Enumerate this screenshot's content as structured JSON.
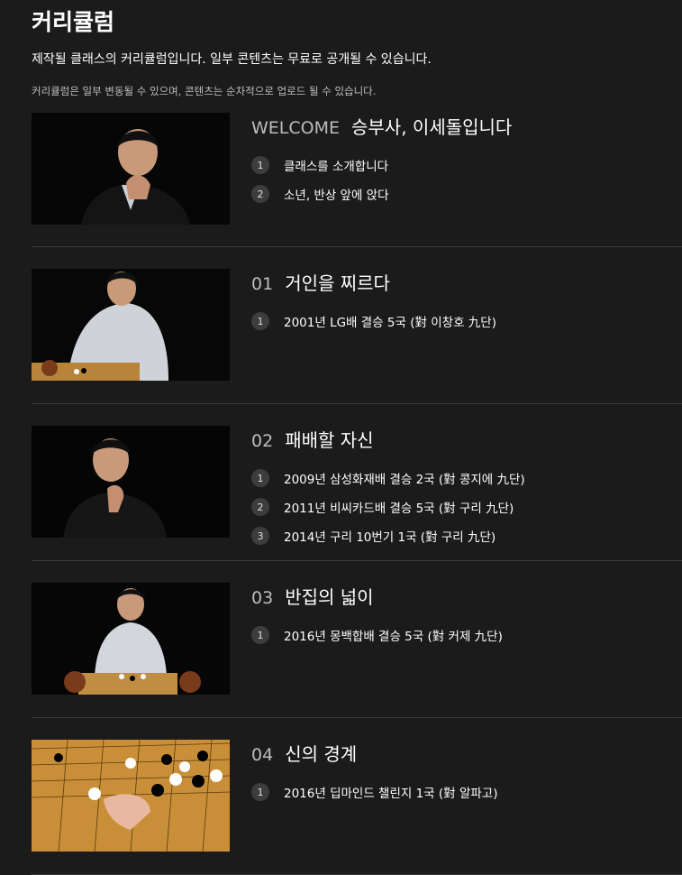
{
  "page": {
    "title": "커리큘럼",
    "subtitle": "제작될 클래스의 커리큘럼입니다. 일부 콘텐츠는 무료로 공개될 수 있습니다.",
    "note": "커리큘럼은 일부 변동될 수 있으며, 콘텐츠는 순차적으로 업로드 될 수 있습니다."
  },
  "chapters": [
    {
      "num": "WELCOME",
      "title": "승부사, 이세돌입니다",
      "lessons": [
        {
          "n": "1",
          "label": "클래스를 소개합니다"
        },
        {
          "n": "2",
          "label": "소년, 반상 앞에 앉다"
        }
      ]
    },
    {
      "num": "01",
      "title": "거인을 찌르다",
      "lessons": [
        {
          "n": "1",
          "label": "2001년 LG배 결승 5국 (對 이창호 九단)"
        }
      ]
    },
    {
      "num": "02",
      "title": "패배할 자신",
      "lessons": [
        {
          "n": "1",
          "label": "2009년 삼성화재배 결승 2국 (對 콩지에 九단)"
        },
        {
          "n": "2",
          "label": "2011년 비씨카드배 결승 5국 (對 구리 九단)"
        },
        {
          "n": "3",
          "label": "2014년 구리 10번기 1국 (對 구리 九단)"
        }
      ]
    },
    {
      "num": "03",
      "title": "반집의 넓이",
      "lessons": [
        {
          "n": "1",
          "label": "2016년 몽백합배 결승 5국 (對 커제 九단)"
        }
      ]
    },
    {
      "num": "04",
      "title": "신의 경계",
      "lessons": [
        {
          "n": "1",
          "label": "2016년 딥마인드 챌린지 1국 (對 알파고)"
        }
      ]
    }
  ]
}
